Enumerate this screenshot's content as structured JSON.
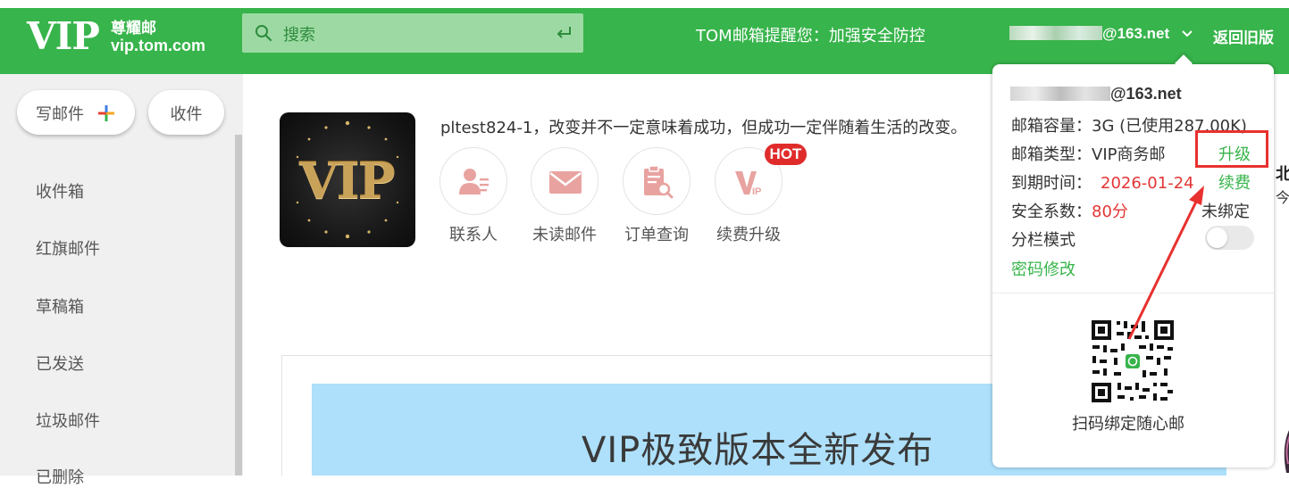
{
  "header": {
    "logo_vip": "VIP",
    "logo_cn": "尊耀邮",
    "logo_url": "vip.tom.com",
    "search_placeholder": "搜索",
    "notice": "TOM邮箱提醒您：加强安全防控",
    "account_suffix": "@163.net",
    "back_old": "返回旧版",
    "colors": {
      "primary": "#37b44b",
      "search_bg": "#9ddaa3"
    }
  },
  "sidebar": {
    "compose_label": "写邮件",
    "receive_label": "收件",
    "items": [
      {
        "label": "收件箱"
      },
      {
        "label": "红旗邮件"
      },
      {
        "label": "草稿箱"
      },
      {
        "label": "已发送"
      },
      {
        "label": "垃圾邮件"
      },
      {
        "label": "已删除"
      }
    ]
  },
  "main": {
    "vip_card_text": "VIP",
    "tagline": "pltest824-1，改变并不一定意味着成功，但成功一定伴随着生活的改变。",
    "quick_actions": [
      {
        "label": "联系人",
        "icon": "contact-icon"
      },
      {
        "label": "未读邮件",
        "icon": "mail-icon"
      },
      {
        "label": "订单查询",
        "icon": "order-search-icon"
      },
      {
        "label": "续费升级",
        "icon": "vip-renew-icon"
      }
    ],
    "hot_badge": "HOT",
    "banner_title": "VIP极致版本全新发布",
    "right_edge_bold": "北",
    "right_edge_small": "今"
  },
  "popup": {
    "email_suffix": "@163.net",
    "capacity_label": "邮箱容量：",
    "capacity_value": "3G (已使用287.00K)",
    "type_label": "邮箱类型：",
    "type_value": "VIP商务邮",
    "upgrade_link": "升级",
    "expire_label": "到期时间：",
    "expire_value": "2026-01-24",
    "renew_link": "续费",
    "security_label": "安全系数：",
    "security_value": "80分",
    "security_status": "未绑定",
    "split_mode_label": "分栏模式",
    "split_mode_on": false,
    "password_link": "密码修改",
    "qr_caption": "扫码绑定随心邮"
  }
}
